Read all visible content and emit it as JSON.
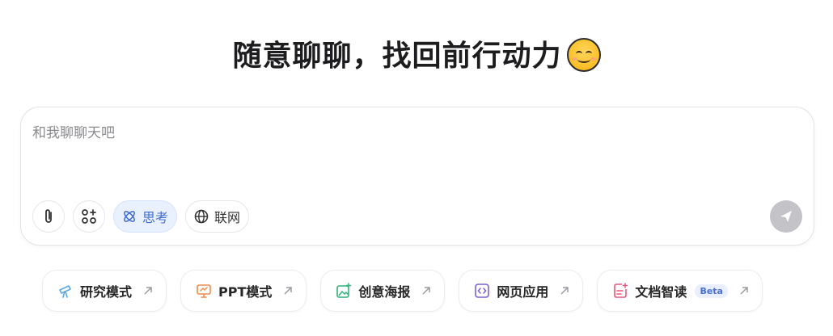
{
  "headline": {
    "text": "随意聊聊，找回前行动力"
  },
  "composer": {
    "placeholder": "和我聊聊天吧",
    "value": "",
    "tools": {
      "think_label": "思考",
      "web_label": "联网"
    }
  },
  "quick_actions": [
    {
      "label": "研究模式",
      "icon": "telescope-icon",
      "color": "#5aa9e6"
    },
    {
      "label": "PPT模式",
      "icon": "presentation-icon",
      "color": "#f08c4a"
    },
    {
      "label": "创意海报",
      "icon": "image-sparkle-icon",
      "color": "#2fb37a"
    },
    {
      "label": "网页应用",
      "icon": "code-window-icon",
      "color": "#7b61d8"
    },
    {
      "label": "文档智读",
      "icon": "document-sparkle-icon",
      "color": "#e8587a",
      "badge": "Beta"
    }
  ],
  "colors": {
    "accent": "#3d6bd4",
    "send_disabled": "#c4c4c8"
  }
}
